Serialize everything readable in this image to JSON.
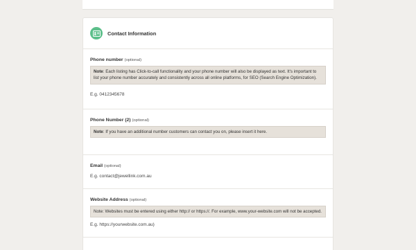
{
  "header": {
    "title": "Contact Information",
    "icon": "contact-card-icon",
    "icon_color": "#5cbf8a"
  },
  "fields": [
    {
      "label": "Phone number",
      "optional": "(optional)",
      "note_prefix": "Note",
      "note_text": ": Each listing has Click-to-call functionality and your phone number will also be displayed as text. It's important to list your phone number accurately and consistently across all online platforms, for SEO (Search Engine Optimization).",
      "example": "E.g. 0412345678"
    },
    {
      "label": "Phone Number (2)",
      "optional": "(optional)",
      "note_prefix": "Note",
      "note_text": ": If you have an additional number customers can contact you on, please insert it here."
    },
    {
      "label": "Email",
      "optional": "(optional)",
      "example": "E.g. contact@jewellink.com.au"
    },
    {
      "label": "Website Address",
      "optional": "(optional)",
      "note_text": "Note: Websites must be entered using either http:// or https://. For example, www.your-website.com will not be accepted.",
      "example": "E.g. https://yourwebsite.com.au)"
    }
  ],
  "colors": {
    "background": "#f1efec",
    "note_bg": "#e6e1da",
    "accent": "#5cbf8a"
  }
}
